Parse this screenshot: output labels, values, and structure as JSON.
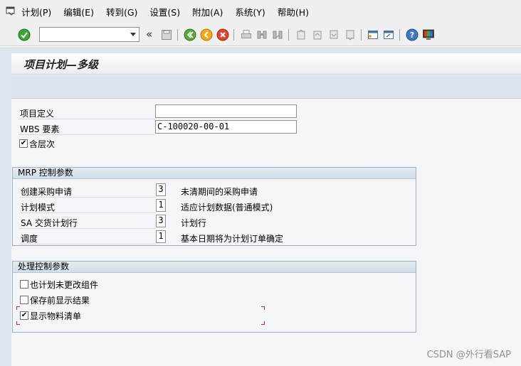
{
  "menu": [
    "计划(P)",
    "编辑(E)",
    "转到(G)",
    "设置(S)",
    "附加(A)",
    "系统(Y)",
    "帮助(H)"
  ],
  "toolbar": {
    "command_value": "",
    "back_glyph": "«"
  },
  "page": {
    "title": "项目计划—多级"
  },
  "selection": {
    "project_def_label": "项目定义",
    "project_def_value": "",
    "wbs_label": "WBS 要素",
    "wbs_value": "C-100020-00-01",
    "with_hierarchy_label": "含层次",
    "with_hierarchy_checked": true
  },
  "mrp": {
    "title": "MRP 控制参数",
    "rows": [
      {
        "label": "创建采购申请",
        "value": "3",
        "desc": "未清期间的采购申请"
      },
      {
        "label": "计划模式",
        "value": "1",
        "desc": "适应计划数据(普通模式)"
      },
      {
        "label": "SA 交货计划行",
        "value": "3",
        "desc": "计划行"
      },
      {
        "label": "调度",
        "value": "1",
        "desc": "基本日期将为计划订单确定"
      }
    ]
  },
  "processing": {
    "title": "处理控制参数",
    "items": [
      {
        "label": "也计划未更改组件",
        "checked": false
      },
      {
        "label": "保存前显示结果",
        "checked": false
      },
      {
        "label": "显示物料清单",
        "checked": true
      }
    ]
  },
  "watermark": "CSDN @外行看SAP",
  "colors": {
    "frame": "#dfe5ec",
    "group_border": "#9fb0c5",
    "focus": "#d0202a"
  }
}
